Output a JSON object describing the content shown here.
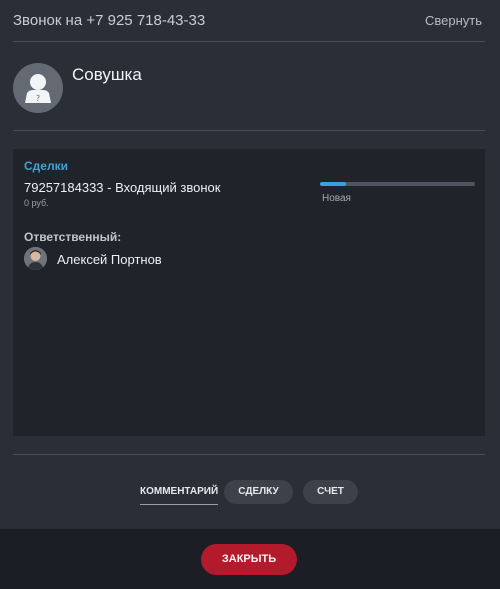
{
  "header": {
    "call_title": "Звонок на +7 925 718-43-33",
    "collapse_label": "Свернуть"
  },
  "contact": {
    "name": "Совушка",
    "avatar_icon": "unknown-person-icon"
  },
  "deals": {
    "heading": "Сделки",
    "deal_title": "79257184333 - Входящий звонок",
    "amount": "0 руб.",
    "stage_label": "Новая",
    "stage_progress_fraction": 0.17,
    "responsible_label": "Ответственный:",
    "responsible_name": "Алексей Портнов"
  },
  "actions": {
    "comment_tab": "КОММЕНТАРИЙ",
    "deal_button": "СДЕЛКУ",
    "invoice_button": "СЧЕТ"
  },
  "footer": {
    "close_label": "ЗАКРЫТЬ"
  },
  "colors": {
    "accent_blue": "#3fa3d3",
    "progress_blue": "#3aa1e0",
    "close_red": "#b31a2c",
    "background": "#2a2e36",
    "panel": "#1f232a"
  }
}
